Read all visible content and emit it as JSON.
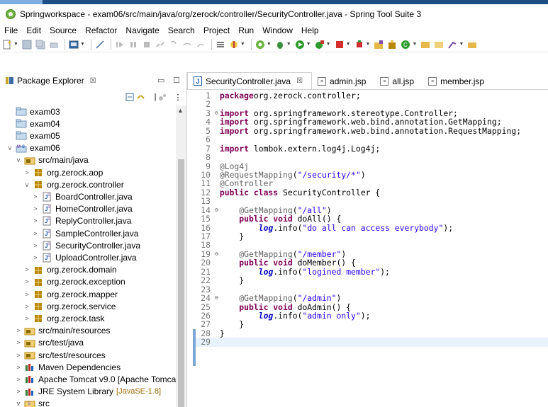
{
  "window": {
    "title": "Springworkspace - exam06/src/main/java/org/zerock/controller/SecurityController.java - Spring Tool Suite 3"
  },
  "menu": [
    "File",
    "Edit",
    "Source",
    "Refactor",
    "Navigate",
    "Search",
    "Project",
    "Run",
    "Window",
    "Help"
  ],
  "package_explorer": {
    "tab_label": "Package Explorer",
    "tab_close": "☒",
    "tree": [
      {
        "label": "exam03",
        "level": 0,
        "toggle": "",
        "icon": "project-icon"
      },
      {
        "label": "exam04",
        "level": 0,
        "toggle": "",
        "icon": "project-icon"
      },
      {
        "label": "exam05",
        "level": 0,
        "toggle": "",
        "icon": "project-icon"
      },
      {
        "label": "exam06",
        "level": 0,
        "toggle": "v",
        "icon": "maven-project-icon"
      },
      {
        "label": "src/main/java",
        "level": 1,
        "toggle": "v",
        "icon": "source-folder-icon"
      },
      {
        "label": "org.zerock.aop",
        "level": 2,
        "toggle": ">",
        "icon": "package-icon"
      },
      {
        "label": "org.zerock.controller",
        "level": 2,
        "toggle": "v",
        "icon": "package-icon"
      },
      {
        "label": "BoardController.java",
        "level": 3,
        "toggle": ">",
        "icon": "java-file-icon"
      },
      {
        "label": "HomeController.java",
        "level": 3,
        "toggle": ">",
        "icon": "java-file-icon"
      },
      {
        "label": "ReplyController.java",
        "level": 3,
        "toggle": ">",
        "icon": "java-file-icon"
      },
      {
        "label": "SampleController.java",
        "level": 3,
        "toggle": ">",
        "icon": "java-file-icon"
      },
      {
        "label": "SecurityController.java",
        "level": 3,
        "toggle": ">",
        "icon": "java-file-icon"
      },
      {
        "label": "UploadController.java",
        "level": 3,
        "toggle": ">",
        "icon": "java-file-icon"
      },
      {
        "label": "org.zerock.domain",
        "level": 2,
        "toggle": ">",
        "icon": "package-icon"
      },
      {
        "label": "org.zerock.exception",
        "level": 2,
        "toggle": ">",
        "icon": "package-icon"
      },
      {
        "label": "org.zerock.mapper",
        "level": 2,
        "toggle": ">",
        "icon": "package-icon"
      },
      {
        "label": "org.zerock.service",
        "level": 2,
        "toggle": ">",
        "icon": "package-icon"
      },
      {
        "label": "org.zerock.task",
        "level": 2,
        "toggle": ">",
        "icon": "package-icon"
      },
      {
        "label": "src/main/resources",
        "level": 1,
        "toggle": ">",
        "icon": "source-folder-icon"
      },
      {
        "label": "src/test/java",
        "level": 1,
        "toggle": ">",
        "icon": "source-folder-icon"
      },
      {
        "label": "src/test/resources",
        "level": 1,
        "toggle": ">",
        "icon": "source-folder-icon"
      },
      {
        "label": "Maven Dependencies",
        "level": 1,
        "toggle": ">",
        "icon": "library-icon"
      },
      {
        "label": "Apache Tomcat v9.0 [Apache Tomca",
        "level": 1,
        "toggle": ">",
        "icon": "library-icon"
      },
      {
        "label": "JRE System Library",
        "decor": "[JavaSE-1.8]",
        "level": 1,
        "toggle": ">",
        "icon": "library-icon"
      },
      {
        "label": "src",
        "level": 1,
        "toggle": "v",
        "icon": "folder-icon"
      }
    ]
  },
  "editor": {
    "tabs": [
      {
        "label": "SecurityController.java",
        "active": true,
        "icon": "java-file-icon",
        "close": "☒"
      },
      {
        "label": "admin.jsp",
        "active": false,
        "icon": "jsp-file-icon"
      },
      {
        "label": "all.jsp",
        "active": false,
        "icon": "jsp-file-icon"
      },
      {
        "label": "member.jsp",
        "active": false,
        "icon": "jsp-file-icon"
      }
    ],
    "current_line": 29,
    "lines": [
      {
        "n": "1",
        "fold": "",
        "tokens": [
          [
            "kw",
            "package"
          ],
          [
            "",
            "org.zerock.controller;"
          ]
        ]
      },
      {
        "n": "2",
        "fold": "",
        "tokens": []
      },
      {
        "n": "3",
        "fold": "⊖",
        "tokens": [
          [
            "kw",
            "import"
          ],
          [
            "",
            " org.springframework.stereotype.Controller;"
          ]
        ]
      },
      {
        "n": "4",
        "fold": "",
        "tokens": [
          [
            "kw",
            "import"
          ],
          [
            "",
            " org.springframework.web.bind.annotation.GetMapping;"
          ]
        ]
      },
      {
        "n": "5",
        "fold": "",
        "tokens": [
          [
            "kw",
            "import"
          ],
          [
            "",
            " org.springframework.web.bind.annotation.RequestMapping;"
          ]
        ]
      },
      {
        "n": "6",
        "fold": "",
        "tokens": []
      },
      {
        "n": "7",
        "fold": "",
        "tokens": [
          [
            "kw",
            "import"
          ],
          [
            "",
            " lombok.extern.log4j.Log4j;"
          ]
        ]
      },
      {
        "n": "8",
        "fold": "",
        "tokens": []
      },
      {
        "n": "9",
        "fold": "",
        "tokens": [
          [
            "ann",
            "@Log4j"
          ]
        ]
      },
      {
        "n": "10",
        "fold": "",
        "tokens": [
          [
            "ann",
            "@RequestMapping"
          ],
          [
            "",
            "("
          ],
          [
            "str",
            "\"/security/*\""
          ],
          [
            "",
            ")"
          ]
        ]
      },
      {
        "n": "11",
        "fold": "",
        "tokens": [
          [
            "ann",
            "@Controller"
          ]
        ]
      },
      {
        "n": "12",
        "fold": "",
        "tokens": [
          [
            "kw",
            "public class"
          ],
          [
            "",
            " SecurityController {"
          ]
        ]
      },
      {
        "n": "13",
        "fold": "",
        "tokens": []
      },
      {
        "n": "14",
        "fold": "⊖",
        "tokens": [
          [
            "",
            "    "
          ],
          [
            "ann",
            "@GetMapping"
          ],
          [
            "",
            "("
          ],
          [
            "str",
            "\"/all\""
          ],
          [
            "",
            ")"
          ]
        ]
      },
      {
        "n": "15",
        "fold": "",
        "tokens": [
          [
            "",
            "    "
          ],
          [
            "kw",
            "public void"
          ],
          [
            "",
            " doAll() {"
          ]
        ]
      },
      {
        "n": "16",
        "fold": "",
        "tokens": [
          [
            "",
            "        "
          ],
          [
            "ital",
            "log"
          ],
          [
            "",
            ".info("
          ],
          [
            "str",
            "\"do all can access everybody\""
          ],
          [
            "",
            ");"
          ]
        ]
      },
      {
        "n": "17",
        "fold": "",
        "tokens": [
          [
            "",
            "    }"
          ]
        ]
      },
      {
        "n": "18",
        "fold": "",
        "tokens": []
      },
      {
        "n": "19",
        "fold": "⊖",
        "tokens": [
          [
            "",
            "    "
          ],
          [
            "ann",
            "@GetMapping"
          ],
          [
            "",
            "("
          ],
          [
            "str",
            "\"/member\""
          ],
          [
            "",
            ")"
          ]
        ]
      },
      {
        "n": "20",
        "fold": "",
        "tokens": [
          [
            "",
            "    "
          ],
          [
            "kw",
            "public void"
          ],
          [
            "",
            " doMember() {"
          ]
        ]
      },
      {
        "n": "21",
        "fold": "",
        "tokens": [
          [
            "",
            "        "
          ],
          [
            "ital",
            "log"
          ],
          [
            "",
            ".info("
          ],
          [
            "str",
            "\"logined member\""
          ],
          [
            "",
            ");"
          ]
        ]
      },
      {
        "n": "22",
        "fold": "",
        "tokens": [
          [
            "",
            "    }"
          ]
        ]
      },
      {
        "n": "23",
        "fold": "",
        "tokens": []
      },
      {
        "n": "24",
        "fold": "⊖",
        "tokens": [
          [
            "",
            "    "
          ],
          [
            "ann",
            "@GetMapping"
          ],
          [
            "",
            "("
          ],
          [
            "str",
            "\"/admin\""
          ],
          [
            "",
            ")"
          ]
        ]
      },
      {
        "n": "25",
        "fold": "",
        "tokens": [
          [
            "",
            "    "
          ],
          [
            "kw",
            "public void"
          ],
          [
            "",
            " doAdmin() {"
          ]
        ]
      },
      {
        "n": "26",
        "fold": "",
        "tokens": [
          [
            "",
            "        "
          ],
          [
            "ital",
            "log"
          ],
          [
            "",
            ".info("
          ],
          [
            "str",
            "\"admin only\""
          ],
          [
            "",
            ");"
          ]
        ]
      },
      {
        "n": "27",
        "fold": "",
        "tokens": [
          [
            "",
            "    }"
          ]
        ]
      },
      {
        "n": "28",
        "fold": "",
        "tokens": [
          [
            "",
            "}"
          ]
        ]
      },
      {
        "n": "29",
        "fold": "",
        "tokens": []
      }
    ]
  }
}
